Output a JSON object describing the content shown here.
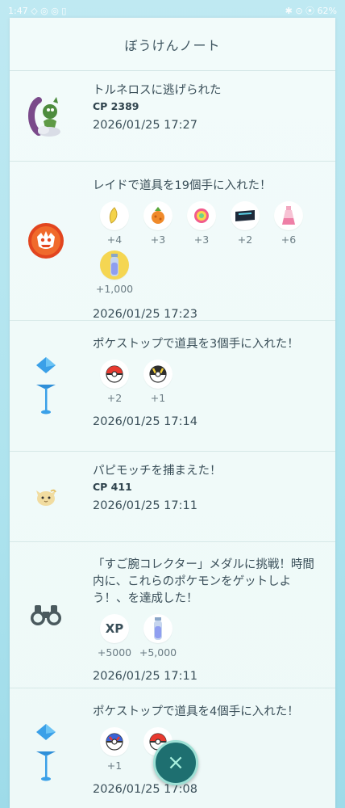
{
  "status_bar": {
    "left": "1:47 ◇ ◎ ◎ ▯",
    "right": "✱ ⊙ ⦿ 62%"
  },
  "header": {
    "title": "ぼうけんノート"
  },
  "entries": [
    {
      "icon": "tornadus-icon",
      "title": "トルネロスに逃げられた",
      "cp": "CP 2389",
      "time": "2026/01/25 17:27"
    },
    {
      "icon": "raid-badge-icon",
      "title": "レイドで道具を19個手に入れた！",
      "items": [
        {
          "icon": "golden-razz-berry-icon",
          "qty": "+4"
        },
        {
          "icon": "pinap-berry-icon",
          "qty": "+3"
        },
        {
          "icon": "rare-candy-icon",
          "qty": "+3"
        },
        {
          "icon": "tm-icon",
          "qty": "+2"
        },
        {
          "icon": "stardust-potion-icon",
          "qty": "+6"
        },
        {
          "icon": "max-particle-icon",
          "qty": "+1,000"
        }
      ],
      "time": "2026/01/25 17:23"
    },
    {
      "icon": "pokestop-icon",
      "title": "ポケストップで道具を3個手に入れた！",
      "items": [
        {
          "icon": "poke-ball-icon",
          "qty": "+2"
        },
        {
          "icon": "ultra-ball-icon",
          "qty": "+1"
        }
      ],
      "time": "2026/01/25 17:14"
    },
    {
      "icon": "pokemon-catch-icon",
      "title": "パピモッチを捕まえた！",
      "cp": "CP 411",
      "time": "2026/01/25 17:11"
    },
    {
      "icon": "binoculars-icon",
      "title": "「すご腕コレクター」メダルに挑戦！時間内に、これらのポケモンをゲットしよう！、を達成した！",
      "items": [
        {
          "icon": "xp-icon",
          "label": "XP",
          "qty": "+5000"
        },
        {
          "icon": "max-particle-icon",
          "qty": "+5,000"
        }
      ],
      "time": "2026/01/25 17:11"
    },
    {
      "icon": "pokestop-icon",
      "title": "ポケストップで道具を4個手に入れた！",
      "items": [
        {
          "icon": "great-ball-icon",
          "qty": "+1"
        },
        {
          "icon": "poke-ball-icon",
          "qty": "+"
        }
      ],
      "time": "2026/01/25 17:08"
    }
  ],
  "close_button": {
    "label": "×"
  }
}
